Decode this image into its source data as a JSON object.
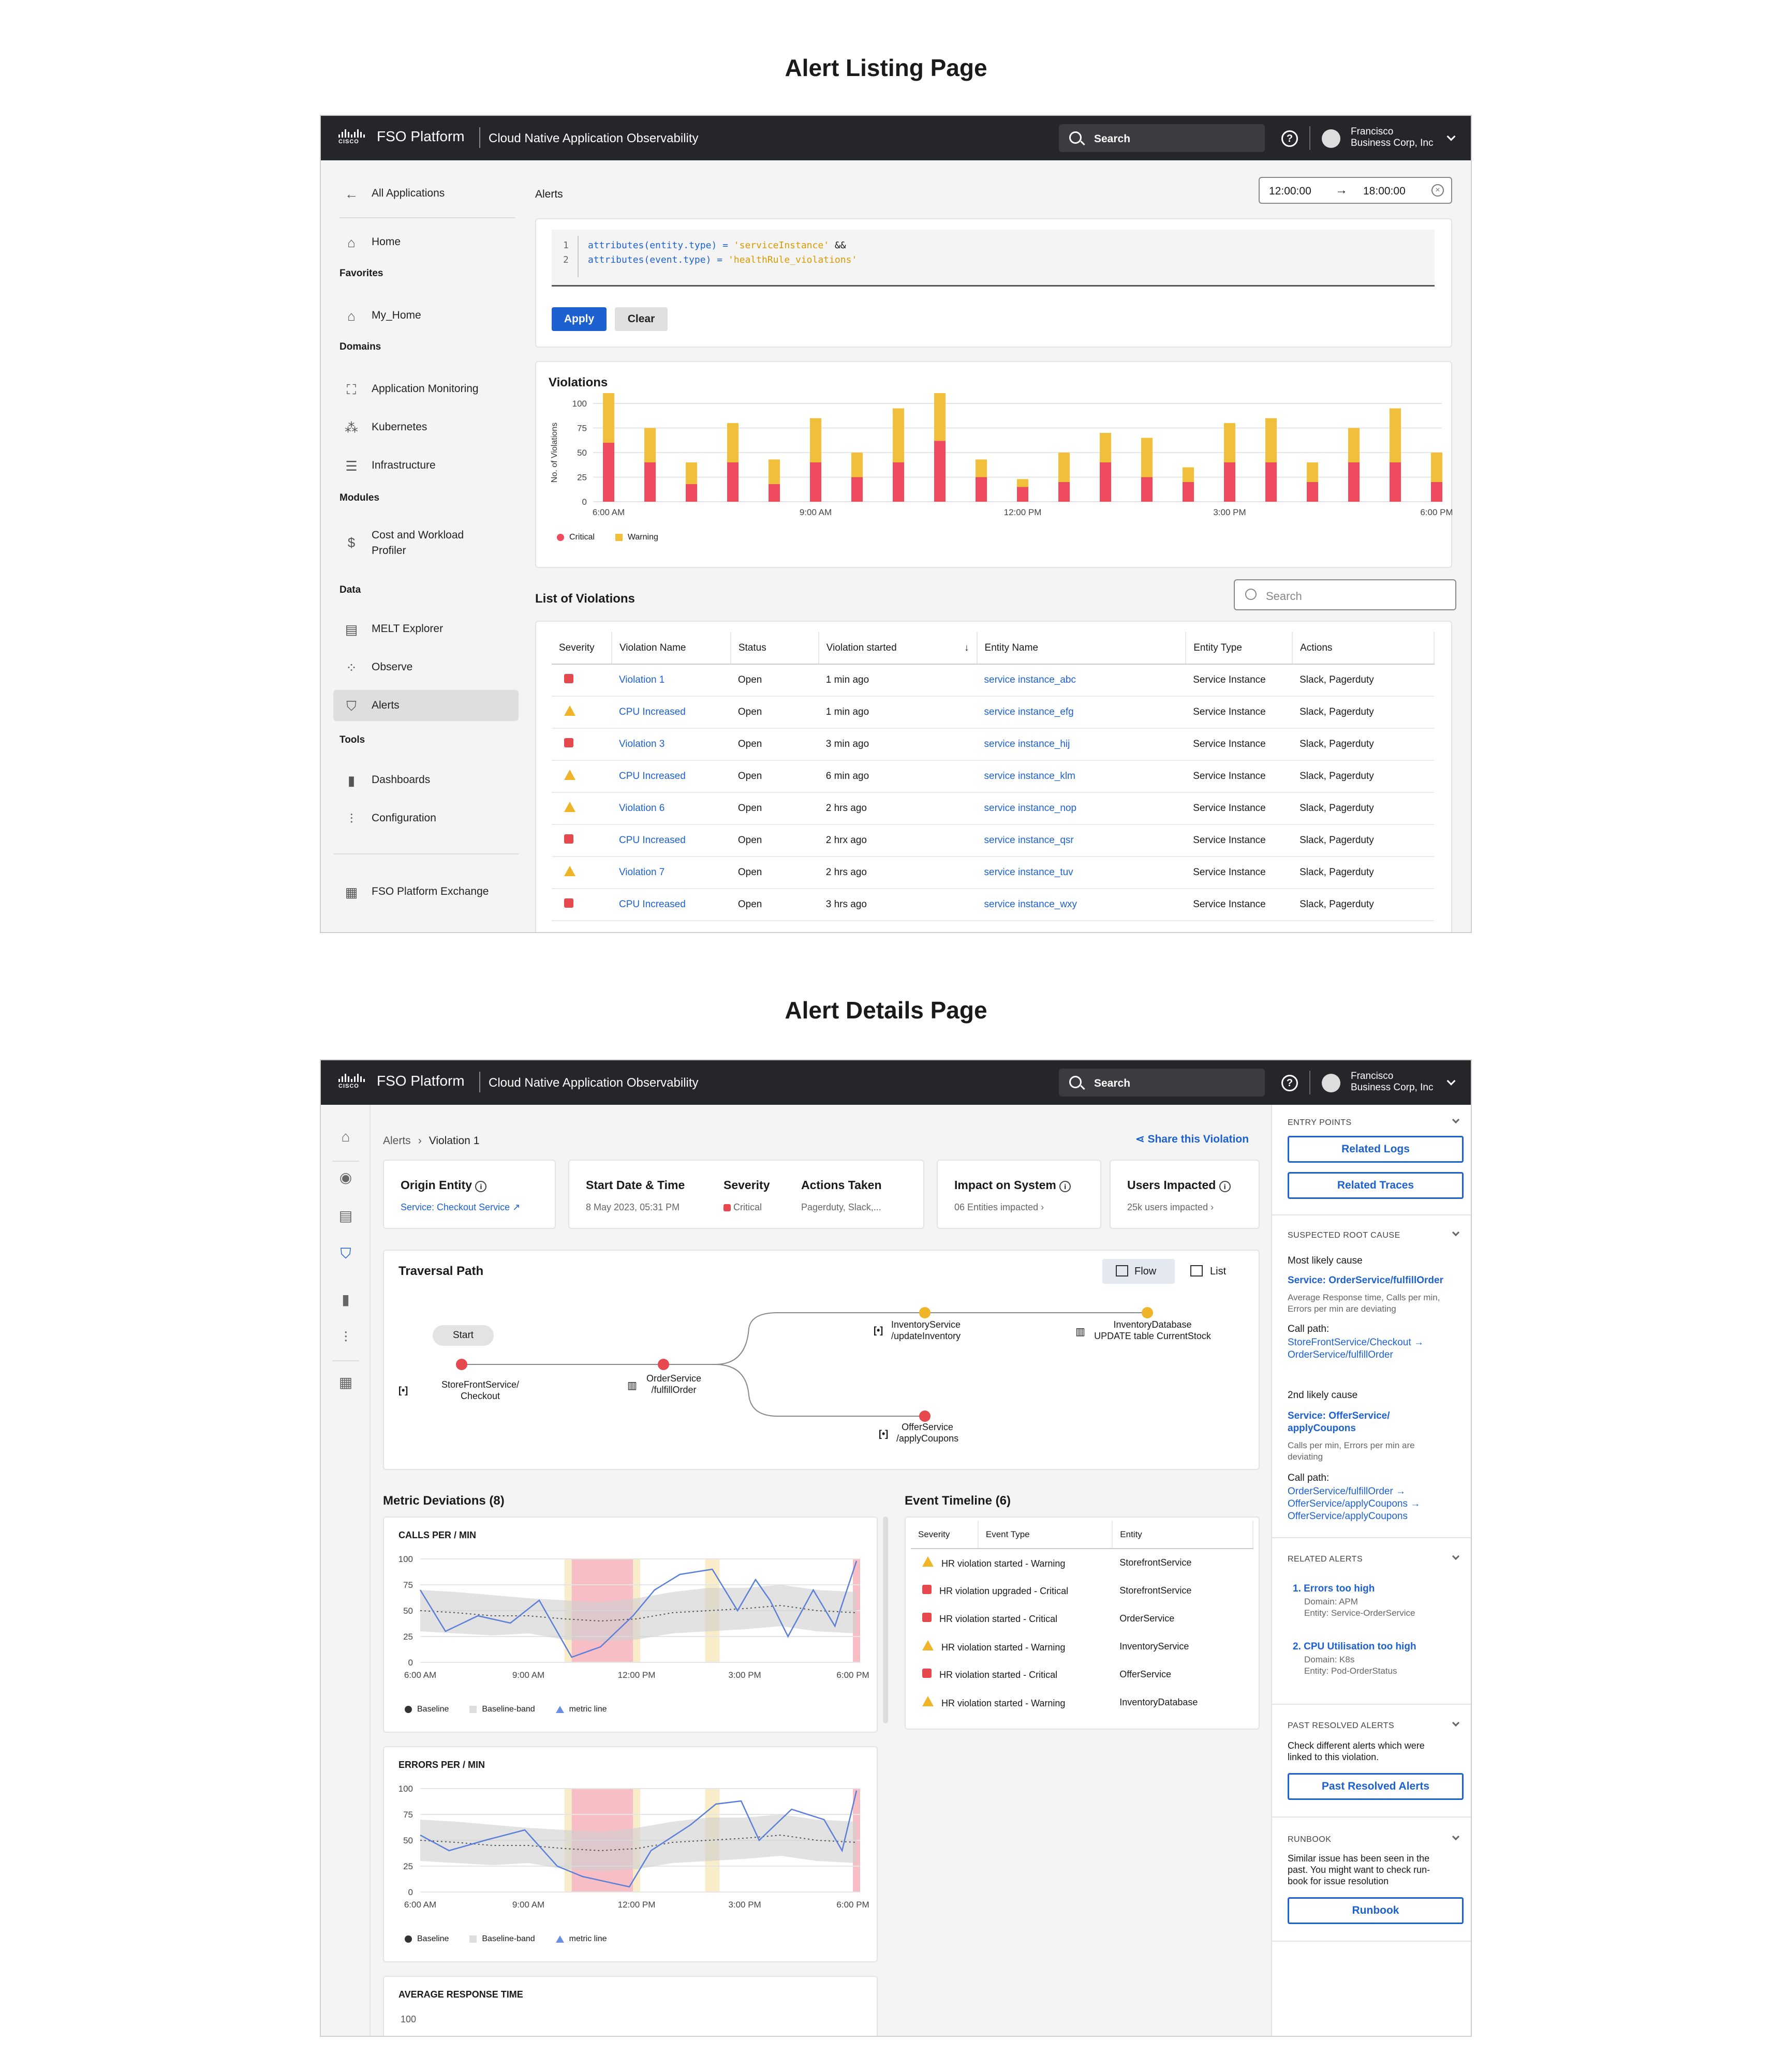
{
  "listing": {
    "page_title": "Alert Listing Page",
    "header": {
      "brand": "FSO Platform",
      "product": "Cloud Native Application Observability",
      "search": "Search",
      "user_name": "Francisco",
      "user_org": "Business Corp, Inc"
    },
    "sidebar": {
      "back": "All Applications",
      "home": "Home",
      "favorites_title": "Favorites",
      "my_home": "My_Home",
      "domains_title": "Domains",
      "app_monitoring": "Application Monitoring",
      "kubernetes": "Kubernetes",
      "infrastructure": "Infrastructure",
      "modules_title": "Modules",
      "cost_line1": "Cost and Workload",
      "cost_line2": "Profiler",
      "data_title": "Data",
      "melt": "MELT Explorer",
      "observe": "Observe",
      "alerts": "Alerts",
      "tools_title": "Tools",
      "dashboards": "Dashboards",
      "configuration": "Configuration",
      "exchange": "FSO Platform Exchange"
    },
    "query": {
      "section": "Alerts",
      "time_from": "12:00:00",
      "time_to": "18:00:00",
      "line1_no": "1",
      "line1_a": "attributes(",
      "line1_b": "entity.type",
      "line1_c": ") = ",
      "line1_d": "'serviceInstance'",
      "line1_e": " &&",
      "line2_no": "2",
      "line2_a": "attributes(",
      "line2_b": "event.type",
      "line2_c": ") = ",
      "line2_d": "'healthRule_violations'",
      "apply": "Apply",
      "clear": "Clear"
    },
    "violations_title": "Violations",
    "list_title": "List of Violations",
    "list_search": "Search",
    "table": {
      "headers": [
        "Severity",
        "Violation Name",
        "Status",
        "Violation started",
        "Entity Name",
        "Entity Type",
        "Actions"
      ],
      "rows": [
        {
          "sev": "crit",
          "name": "Violation 1",
          "status": "Open",
          "started": "1 min ago",
          "entity": "service instance_abc",
          "type": "Service Instance",
          "actions": "Slack, Pagerduty"
        },
        {
          "sev": "warn",
          "name": "CPU Increased",
          "status": "Open",
          "started": "1 min ago",
          "entity": "service instance_efg",
          "type": "Service Instance",
          "actions": "Slack, Pagerduty"
        },
        {
          "sev": "crit",
          "name": "Violation 3",
          "status": "Open",
          "started": "3 min ago",
          "entity": "service instance_hij",
          "type": "Service Instance",
          "actions": "Slack, Pagerduty"
        },
        {
          "sev": "warn",
          "name": "CPU Increased",
          "status": "Open",
          "started": "6 min ago",
          "entity": "service instance_klm",
          "type": "Service Instance",
          "actions": "Slack, Pagerduty"
        },
        {
          "sev": "warn",
          "name": "Violation 6",
          "status": "Open",
          "started": "2 hrs ago",
          "entity": "service instance_nop",
          "type": "Service Instance",
          "actions": "Slack, Pagerduty"
        },
        {
          "sev": "crit",
          "name": "CPU Increased",
          "status": "Open",
          "started": "2 hrx ago",
          "entity": "service instance_qsr",
          "type": "Service Instance",
          "actions": "Slack, Pagerduty"
        },
        {
          "sev": "warn",
          "name": "Violation 7",
          "status": "Open",
          "started": "2 hrs ago",
          "entity": "service instance_tuv",
          "type": "Service Instance",
          "actions": "Slack, Pagerduty"
        },
        {
          "sev": "crit",
          "name": "CPU Increased",
          "status": "Open",
          "started": "3 hrs ago",
          "entity": "service instance_wxy",
          "type": "Service Instance",
          "actions": "Slack, Pagerduty"
        }
      ]
    }
  },
  "details": {
    "page_title": "Alert Details Page",
    "breadcrumb_root": "Alerts",
    "breadcrumb_leaf": "Violation 1",
    "share": "Share this Violation",
    "origin_title": "Origin Entity",
    "origin_value": "Service: Checkout Service",
    "start_title": "Start Date & Time",
    "start_value": "8 May 2023, 05:31 PM",
    "severity_title": "Severity",
    "severity_value": "Critical",
    "actions_title": "Actions Taken",
    "actions_value": "Pagerduty, Slack,...",
    "impact_title": "Impact on System",
    "impact_value": "06 Entities impacted",
    "users_title": "Users Impacted",
    "users_value": "25k users impacted",
    "traversal_title": "Traversal Path",
    "flow": "Flow",
    "list": "List",
    "start_node": "Start",
    "node_store1": "StoreFrontService/",
    "node_store2": "Checkout",
    "node_order1": "OrderService",
    "node_order2": "/fulfillOrder",
    "node_inv1": "InventoryService",
    "node_inv2": "/updateInventory",
    "node_db1": "InventoryDatabase",
    "node_db2": "UPDATE table CurrentStock",
    "node_offer1": "OfferService",
    "node_offer2": "/applyCoupons",
    "metric_title": "Metric Deviations (8)",
    "event_title": "Event Timeline (6)",
    "chart1_title": "CALLS PER / MIN",
    "chart2_title": "ERRORS PER / MIN",
    "chart3_title": "AVERAGE RESPONSE TIME",
    "chart3_tick": "100",
    "legend_baseline": "Baseline",
    "legend_band": "Baseline-band",
    "legend_metric": "metric line",
    "events": {
      "headers": [
        "Severity",
        "Event Type",
        "Entity"
      ],
      "rows": [
        {
          "sev": "warn",
          "type": "HR violation started - Warning",
          "entity": "StorefrontService"
        },
        {
          "sev": "crit",
          "type": "HR violation upgraded - Critical",
          "entity": "StorefrontService"
        },
        {
          "sev": "crit",
          "type": "HR violation started - Critical",
          "entity": "OrderService"
        },
        {
          "sev": "warn",
          "type": "HR violation started - Warning",
          "entity": "InventoryService"
        },
        {
          "sev": "crit",
          "type": "HR violation started - Critical",
          "entity": "OfferService"
        },
        {
          "sev": "warn",
          "type": "HR violation started - Warning",
          "entity": "InventoryDatabase"
        }
      ]
    },
    "right": {
      "entry_points": "ENTRY POINTS",
      "related_logs": "Related Logs",
      "related_traces": "Related Traces",
      "root_cause": "SUSPECTED ROOT CAUSE",
      "most_likely": "Most likely cause",
      "cause1_service": "Service: OrderService/fulfillOrder",
      "cause1_desc1": "Average Response time, Calls per min,",
      "cause1_desc2": "Errors per min are deviating",
      "call_path": "Call path:",
      "cause1_path1": "StoreFrontService/Checkout →",
      "cause1_path2": "OrderService/fulfillOrder",
      "second_likely": "2nd likely cause",
      "cause2_service1": "Service: OfferService/",
      "cause2_service2": "applyCoupons",
      "cause2_desc1": "Calls per min, Errors per min are",
      "cause2_desc2": "deviating",
      "cause2_path1": "OrderService/fulfillOrder →",
      "cause2_path2": "OfferService/applyCoupons →",
      "cause2_path3": "OfferService/applyCoupons",
      "related_alerts": "RELATED ALERTS",
      "ra1_title": "1. Errors too high",
      "ra1_domain": "Domain: APM",
      "ra1_entity": "Entity: Service-OrderService",
      "ra2_title": "2. CPU Utilisation too high",
      "ra2_domain": "Domain: K8s",
      "ra2_entity": "Entity: Pod-OrderStatus",
      "past_resolved": "PAST RESOLVED ALERTS",
      "past_desc1": "Check different alerts which were",
      "past_desc2": "linked to this violation.",
      "past_btn": "Past Resolved Alerts",
      "runbook": "RUNBOOK",
      "runbook_desc1": "Similar issue has been seen in the",
      "runbook_desc2": "past. You might want to check run-",
      "runbook_desc3": "book for issue resolution",
      "runbook_btn": "Runbook"
    }
  },
  "chart_data": [
    {
      "type": "bar",
      "title": "Violations",
      "ylabel": "No. of Violations",
      "ylim": [
        0,
        100
      ],
      "yticks": [
        0,
        25,
        50,
        75,
        100
      ],
      "x_ticks": [
        "6:00 AM",
        "9:00 AM",
        "12:00 PM",
        "3:00 PM",
        "6:00 PM"
      ],
      "stacked": true,
      "series": [
        {
          "name": "Critical",
          "color": "#ee4b5f",
          "values": [
            60,
            40,
            18,
            40,
            18,
            40,
            25,
            40,
            62,
            25,
            15,
            20,
            40,
            25,
            20,
            40,
            40,
            20,
            40,
            40,
            20
          ]
        },
        {
          "name": "Warning",
          "color": "#f2bf3a",
          "values": [
            60,
            35,
            22,
            40,
            25,
            45,
            25,
            55,
            65,
            18,
            8,
            30,
            30,
            40,
            15,
            40,
            45,
            20,
            35,
            55,
            30
          ]
        }
      ]
    },
    {
      "type": "line",
      "title": "CALLS PER / MIN",
      "ylim": [
        0,
        100
      ],
      "yticks": [
        0,
        25,
        50,
        75,
        100
      ],
      "x_ticks": [
        "6:00 AM",
        "9:00 AM",
        "12:00 PM",
        "3:00 PM",
        "6:00 PM"
      ],
      "xlim": [
        6,
        18.2
      ],
      "series": [
        {
          "name": "metric line",
          "x": [
            6,
            6.7,
            7.6,
            8.5,
            9.3,
            10.2,
            11,
            11.9,
            12.5,
            13.2,
            14.1,
            14.8,
            15.3,
            15.7,
            16.2,
            16.9,
            17.5,
            18.1
          ],
          "values": [
            70,
            30,
            45,
            38,
            60,
            5,
            15,
            45,
            70,
            85,
            90,
            50,
            80,
            60,
            25,
            70,
            35,
            98
          ]
        },
        {
          "name": "Baseline",
          "x": [
            6,
            7,
            8,
            9,
            10,
            11,
            12,
            13,
            14,
            15,
            16,
            17,
            18.1
          ],
          "values": [
            50,
            48,
            45,
            45,
            42,
            40,
            42,
            48,
            50,
            52,
            55,
            50,
            48
          ]
        }
      ],
      "band": {
        "x": [
          6,
          7,
          8,
          9,
          10,
          11,
          12,
          13,
          14,
          15,
          16,
          17,
          18.1
        ],
        "upper": [
          70,
          68,
          65,
          62,
          60,
          58,
          62,
          68,
          72,
          72,
          75,
          70,
          68
        ],
        "lower": [
          30,
          28,
          26,
          28,
          22,
          20,
          22,
          28,
          30,
          32,
          35,
          30,
          28
        ]
      },
      "highlights": [
        {
          "from": 10.2,
          "to": 11.9,
          "color": "#f5a3ad"
        },
        {
          "from": 10.0,
          "to": 10.2,
          "color": "#f7e4b0"
        },
        {
          "from": 11.9,
          "to": 12.1,
          "color": "#f7e4b0"
        },
        {
          "from": 13.9,
          "to": 14.3,
          "color": "#f7e4b0"
        },
        {
          "from": 18.0,
          "to": 18.2,
          "color": "#f5a3ad"
        }
      ]
    },
    {
      "type": "line",
      "title": "ERRORS PER / MIN",
      "ylim": [
        0,
        100
      ],
      "yticks": [
        0,
        25,
        50,
        75,
        100
      ],
      "x_ticks": [
        "6:00 AM",
        "9:00 AM",
        "12:00 PM",
        "3:00 PM",
        "6:00 PM"
      ],
      "xlim": [
        6,
        18.2
      ],
      "series": [
        {
          "name": "metric line",
          "x": [
            6,
            6.8,
            7.8,
            8.9,
            9.8,
            10.5,
            11.8,
            12.4,
            13.5,
            14.2,
            14.9,
            15.4,
            16.3,
            17.2,
            17.7,
            18.1
          ],
          "values": [
            55,
            40,
            50,
            60,
            25,
            15,
            5,
            40,
            65,
            85,
            88,
            50,
            80,
            70,
            40,
            98
          ]
        },
        {
          "name": "Baseline",
          "x": [
            6,
            7,
            8,
            9,
            10,
            11,
            12,
            13,
            14,
            15,
            16,
            17,
            18.1
          ],
          "values": [
            50,
            48,
            45,
            45,
            42,
            40,
            42,
            48,
            50,
            52,
            55,
            50,
            48
          ]
        }
      ],
      "band": {
        "x": [
          6,
          7,
          8,
          9,
          10,
          11,
          12,
          13,
          14,
          15,
          16,
          17,
          18.1
        ],
        "upper": [
          70,
          68,
          65,
          62,
          60,
          58,
          62,
          68,
          72,
          72,
          75,
          70,
          68
        ],
        "lower": [
          30,
          28,
          26,
          28,
          22,
          20,
          22,
          28,
          30,
          32,
          35,
          30,
          28
        ]
      },
      "highlights": [
        {
          "from": 10.2,
          "to": 11.9,
          "color": "#f5a3ad"
        },
        {
          "from": 10.0,
          "to": 10.2,
          "color": "#f7e4b0"
        },
        {
          "from": 11.9,
          "to": 12.1,
          "color": "#f7e4b0"
        },
        {
          "from": 13.9,
          "to": 14.3,
          "color": "#f7e4b0"
        },
        {
          "from": 18.0,
          "to": 18.2,
          "color": "#f5a3ad"
        }
      ]
    }
  ]
}
